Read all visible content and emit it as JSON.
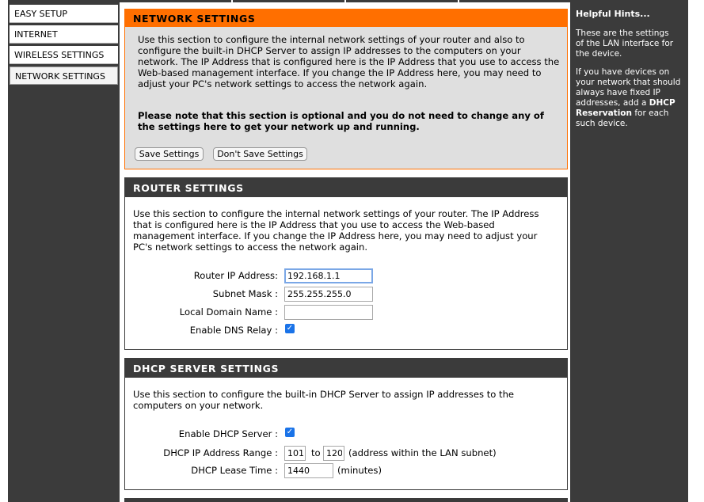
{
  "nav": {
    "items": [
      {
        "label": "EASY SETUP"
      },
      {
        "label": "INTERNET"
      },
      {
        "label": "WIRELESS SETTINGS"
      },
      {
        "label": "NETWORK SETTINGS"
      }
    ]
  },
  "network": {
    "title": "NETWORK SETTINGS",
    "desc": "Use this section to configure the internal network settings of your router and also to configure the built-in DHCP Server to assign IP addresses to the computers on your network. The IP Address that is configured here is the IP Address that you use to access the Web-based management interface. If you change the IP Address here, you may need to adjust your PC's network settings to access the network again.",
    "note": "Please note that this section is optional and you do not need to change any of the settings here to get your network up and running.",
    "save_label": "Save Settings",
    "dont_save_label": "Don't Save Settings"
  },
  "router": {
    "title": "ROUTER SETTINGS",
    "desc": "Use this section to configure the internal network settings of your router. The IP Address that is configured here is the IP Address that you use to access the Web-based management interface. If you change the IP Address here, you may need to adjust your PC's network settings to access the network again.",
    "ip_label": "Router IP Address:",
    "ip_value": "192.168.1.1",
    "mask_label": "Subnet Mask :",
    "mask_value": "255.255.255.0",
    "domain_label": "Local Domain Name :",
    "domain_value": "",
    "dns_label": "Enable DNS Relay :",
    "dns_checked": true
  },
  "dhcp": {
    "title": "DHCP SERVER SETTINGS",
    "desc": "Use this section to configure the built-in DHCP Server to assign IP addresses to the computers on your network.",
    "enable_label": "Enable DHCP Server :",
    "enable_checked": true,
    "range_label": "DHCP IP Address Range :",
    "range_start": "101",
    "range_to": "to",
    "range_end": "120",
    "range_note": "(address within the LAN subnet)",
    "lease_label": "DHCP Lease Time :",
    "lease_value": "1440",
    "lease_unit": "(minutes)"
  },
  "hints": {
    "title": "Helpful Hints...",
    "p1": "These are the settings of the LAN interface for the device.",
    "p2_pre": "If you have devices on your network that should always have fixed IP addresses, add a",
    "p2_bold": "DHCP Reservation",
    "p2_post": "for each such device."
  },
  "colors": {
    "accent": "#ff6f00",
    "dark": "#3b3b3b",
    "check": "#1a73e8"
  },
  "icons": [
    "checkbox-checked-icon"
  ]
}
